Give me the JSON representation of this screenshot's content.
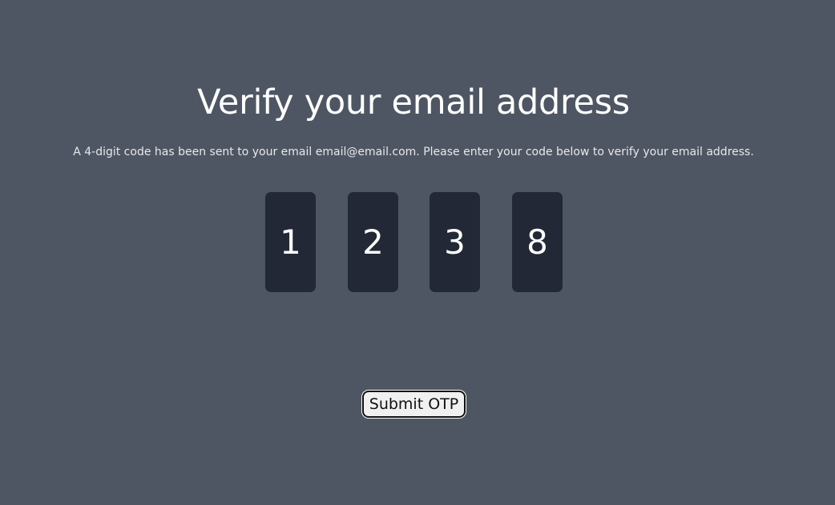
{
  "heading": "Verify your email address",
  "message": "A 4-digit code has been sent to your email email@email.com. Please enter your code below to verify your email address.",
  "otp": {
    "digits": [
      "1",
      "2",
      "3",
      "8"
    ]
  },
  "submit": {
    "label": "Submit OTP"
  },
  "colors": {
    "background": "#4f5663",
    "otp_box": "#222835",
    "text": "#ffffff",
    "button_bg": "#f0f0f0"
  }
}
